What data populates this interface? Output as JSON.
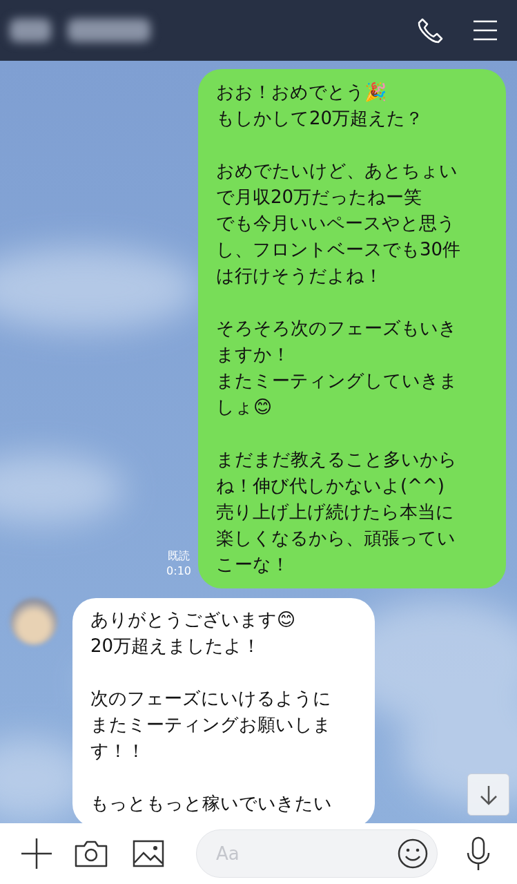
{
  "messages": [
    {
      "kind": "sent",
      "read_label": "既読",
      "time": "0:10",
      "paragraphs": [
        [
          "おお！おめでとう🎉",
          "もしかして20万超えた？"
        ],
        [
          "おめでたいけど、あとちょい",
          "で月収20万だったねー笑",
          "でも今月いいペースやと思う",
          "し、フロントベースでも30件",
          "は行けそうだよね！"
        ],
        [
          "そろそろ次のフェーズもいき",
          "ますか！",
          "またミーティングしていきま",
          "しょ😊"
        ],
        [
          "まだまだ教えること多いから",
          "ね！伸び代しかないよ(^^)",
          "売り上げ上げ続けたら本当に",
          "楽しくなるから、頑張ってい",
          "こーな！"
        ]
      ]
    },
    {
      "kind": "received",
      "paragraphs": [
        [
          "ありがとうございます😊",
          "20万超えましたよ！"
        ],
        [
          "次のフェーズにいけるように",
          "またミーティングお願いしま",
          "す！！"
        ],
        [
          "もっともっと稼いでいきたい"
        ]
      ]
    }
  ],
  "composer": {
    "placeholder": "Aa"
  }
}
